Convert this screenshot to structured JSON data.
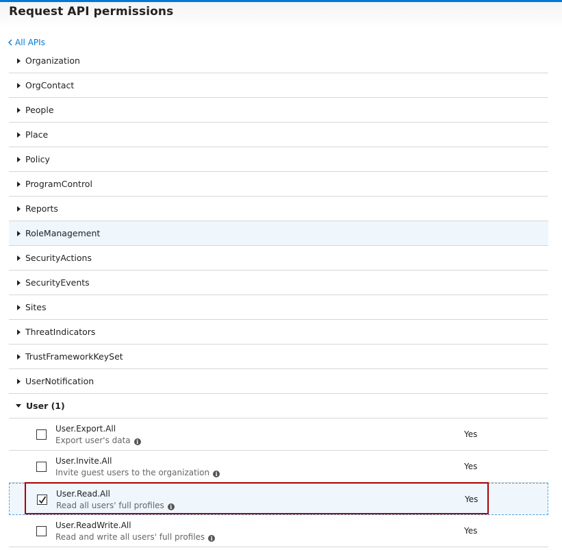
{
  "header": {
    "title": "Request API permissions"
  },
  "nav": {
    "back_label": "All APIs"
  },
  "groups": [
    {
      "label": "Organization"
    },
    {
      "label": "OrgContact"
    },
    {
      "label": "People"
    },
    {
      "label": "Place"
    },
    {
      "label": "Policy"
    },
    {
      "label": "ProgramControl"
    },
    {
      "label": "Reports"
    },
    {
      "label": "RoleManagement"
    },
    {
      "label": "SecurityActions"
    },
    {
      "label": "SecurityEvents"
    },
    {
      "label": "Sites"
    },
    {
      "label": "ThreatIndicators"
    },
    {
      "label": "TrustFrameworkKeySet"
    },
    {
      "label": "UserNotification"
    },
    {
      "label": "User (1)"
    }
  ],
  "permissions": [
    {
      "name": "User.Export.All",
      "description": "Export user's data",
      "admin_consent": "Yes",
      "checked": false
    },
    {
      "name": "User.Invite.All",
      "description": "Invite guest users to the organization",
      "admin_consent": "Yes",
      "checked": false
    },
    {
      "name": "User.Read.All",
      "description": "Read all users' full profiles",
      "admin_consent": "Yes",
      "checked": true
    },
    {
      "name": "User.ReadWrite.All",
      "description": "Read and write all users' full profiles",
      "admin_consent": "Yes",
      "checked": false
    }
  ],
  "colors": {
    "accent": "#0078d4",
    "highlight": "#a80000",
    "hover_row": "#eff6fc"
  },
  "icons": {
    "back": "chevron-left-icon",
    "expand": "caret-right-icon",
    "collapse": "caret-down-icon",
    "info": "info-icon"
  }
}
